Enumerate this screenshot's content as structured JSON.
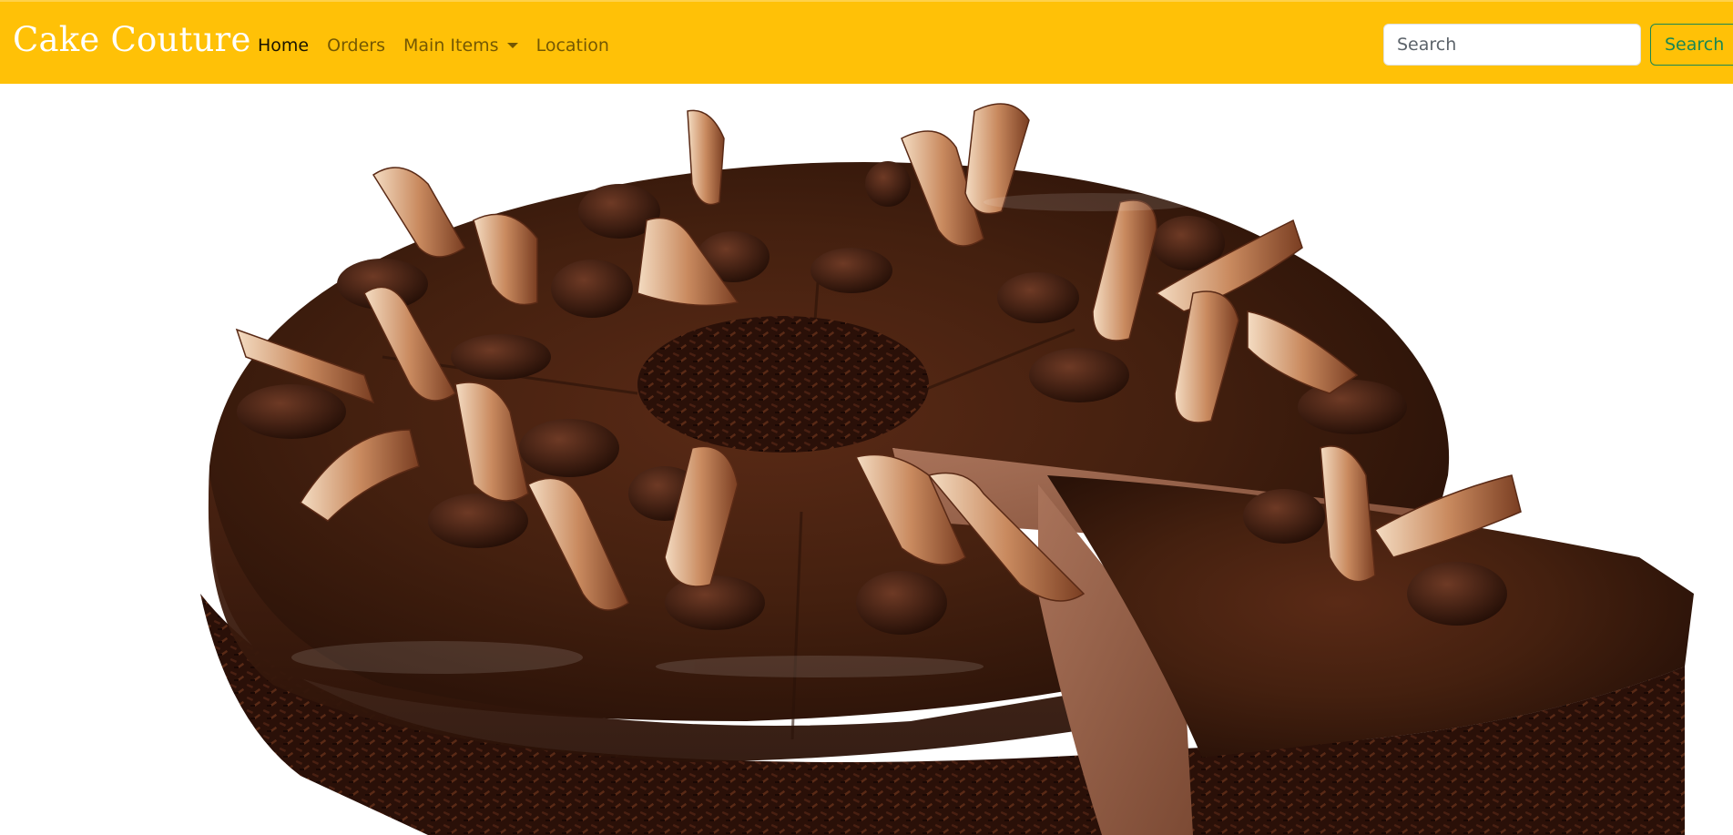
{
  "navbar": {
    "brand": "Cake Couture",
    "links": [
      {
        "label": "Home",
        "active": true
      },
      {
        "label": "Orders",
        "active": false
      },
      {
        "label": "Main Items",
        "active": false,
        "dropdown": true
      },
      {
        "label": "Location",
        "active": false
      }
    ],
    "search": {
      "placeholder": "Search",
      "button_label": "Search"
    }
  },
  "hero": {
    "image": "chocolate-cake-photo"
  },
  "colors": {
    "navbar_bg": "#ffc107",
    "brand_text": "#ffffff",
    "search_button": "#198754",
    "chocolate": "#3b1a0d"
  }
}
